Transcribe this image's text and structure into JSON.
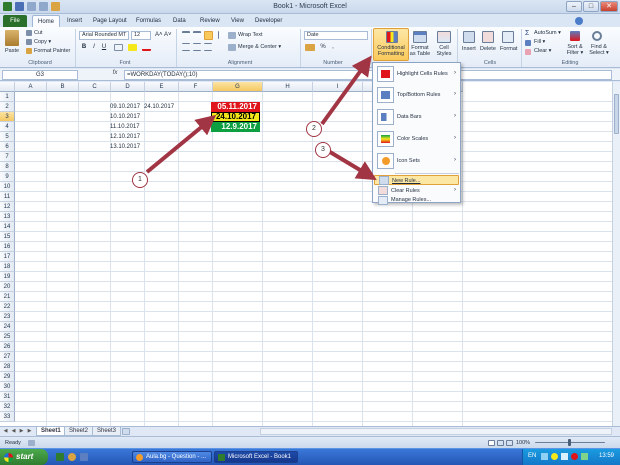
{
  "window": {
    "title": "Book1 - Microsoft Excel"
  },
  "tabs": [
    "File",
    "Home",
    "Insert",
    "Page Layout",
    "Formulas",
    "Data",
    "Review",
    "View",
    "Developer"
  ],
  "ribbon": {
    "clipboard": {
      "paste": "Paste",
      "cut": "Cut",
      "copy": "Copy ▾",
      "format_painter": "Format Painter",
      "label": "Clipboard"
    },
    "font": {
      "family": "Arial Rounded MT",
      "size": "12",
      "grow": "A˄",
      "shrink": "A˅",
      "bold": "B",
      "italic": "I",
      "underline": "U",
      "label": "Font"
    },
    "alignment": {
      "wrap_text": "Wrap Text",
      "merge_center": "Merge & Center ▾",
      "label": "Alignment"
    },
    "number": {
      "format": "Date",
      "percent": "%",
      "comma": ",",
      "label": "Number"
    },
    "styles": {
      "conditional_formatting": "Conditional Formatting",
      "format_as_table": "Format as Table",
      "cell_styles": "Cell Styles"
    },
    "cells": {
      "insert": "Insert",
      "delete": "Delete",
      "format": "Format",
      "label": "Cells"
    },
    "editing": {
      "autosum": "AutoSum ▾",
      "fill": "Fill ▾",
      "clear": "Clear ▾",
      "sort_filter": "Sort & Filter ▾",
      "find_select": "Find & Select ▾",
      "label": "Editing"
    }
  },
  "formula_bar": {
    "name_box": "G3",
    "fx": "fx",
    "formula": "=WORKDAY(TODAY();10)"
  },
  "columns": [
    "A",
    "B",
    "C",
    "D",
    "E",
    "F",
    "G",
    "H",
    "I",
    "J",
    "K"
  ],
  "rows": [
    "1",
    "2",
    "3",
    "4",
    "5",
    "6",
    "7",
    "8",
    "9",
    "10",
    "11",
    "12",
    "13",
    "14",
    "15",
    "16",
    "17",
    "18",
    "19",
    "20",
    "21",
    "22",
    "23",
    "24",
    "25",
    "26",
    "27",
    "28",
    "29",
    "30",
    "31",
    "32",
    "33"
  ],
  "selected_cell": "G3",
  "cells": {
    "d2": "09.10.2017",
    "e2": "24.10.2017",
    "d3": "10.10.2017",
    "d4": "11.10.2017",
    "d5": "12.10.2017",
    "d6": "13.10.2017"
  },
  "formatted_cells": {
    "g2": {
      "value": "05.11.2017",
      "bg": "#e0141b",
      "fg": "#ffffff"
    },
    "g3": {
      "value": "24.10.2017",
      "bg": "#f5e81a",
      "fg": "#000000"
    },
    "g4": {
      "value": "12.9.2017",
      "bg": "#0ea040",
      "fg": "#ffffff"
    }
  },
  "cf_menu": {
    "items": [
      {
        "label": "Highlight Cells Rules",
        "arrow": "›"
      },
      {
        "label": "Top/Bottom Rules",
        "arrow": "›"
      },
      {
        "label": "Data Bars",
        "arrow": "›"
      },
      {
        "label": "Color Scales",
        "arrow": "›"
      },
      {
        "label": "Icon Sets",
        "arrow": "›"
      }
    ],
    "new_rule": "New Rule...",
    "clear_rules": "Clear Rules",
    "clear_arrow": "›",
    "manage_rules": "Manage Rules..."
  },
  "sheets": [
    "Sheet1",
    "Sheet2",
    "Sheet3"
  ],
  "status": {
    "ready": "Ready",
    "zoom": "100%"
  },
  "taskbar": {
    "start": "start",
    "items": [
      "Aula.bg - Question - ...",
      "Microsoft Excel - Book1"
    ],
    "lang": "EN",
    "time": "13:59"
  },
  "annotations": [
    "1",
    "2",
    "3"
  ],
  "colors": {
    "accent": "#a23543",
    "excel_green": "#2a6f2a",
    "selection": "#f5c862"
  }
}
